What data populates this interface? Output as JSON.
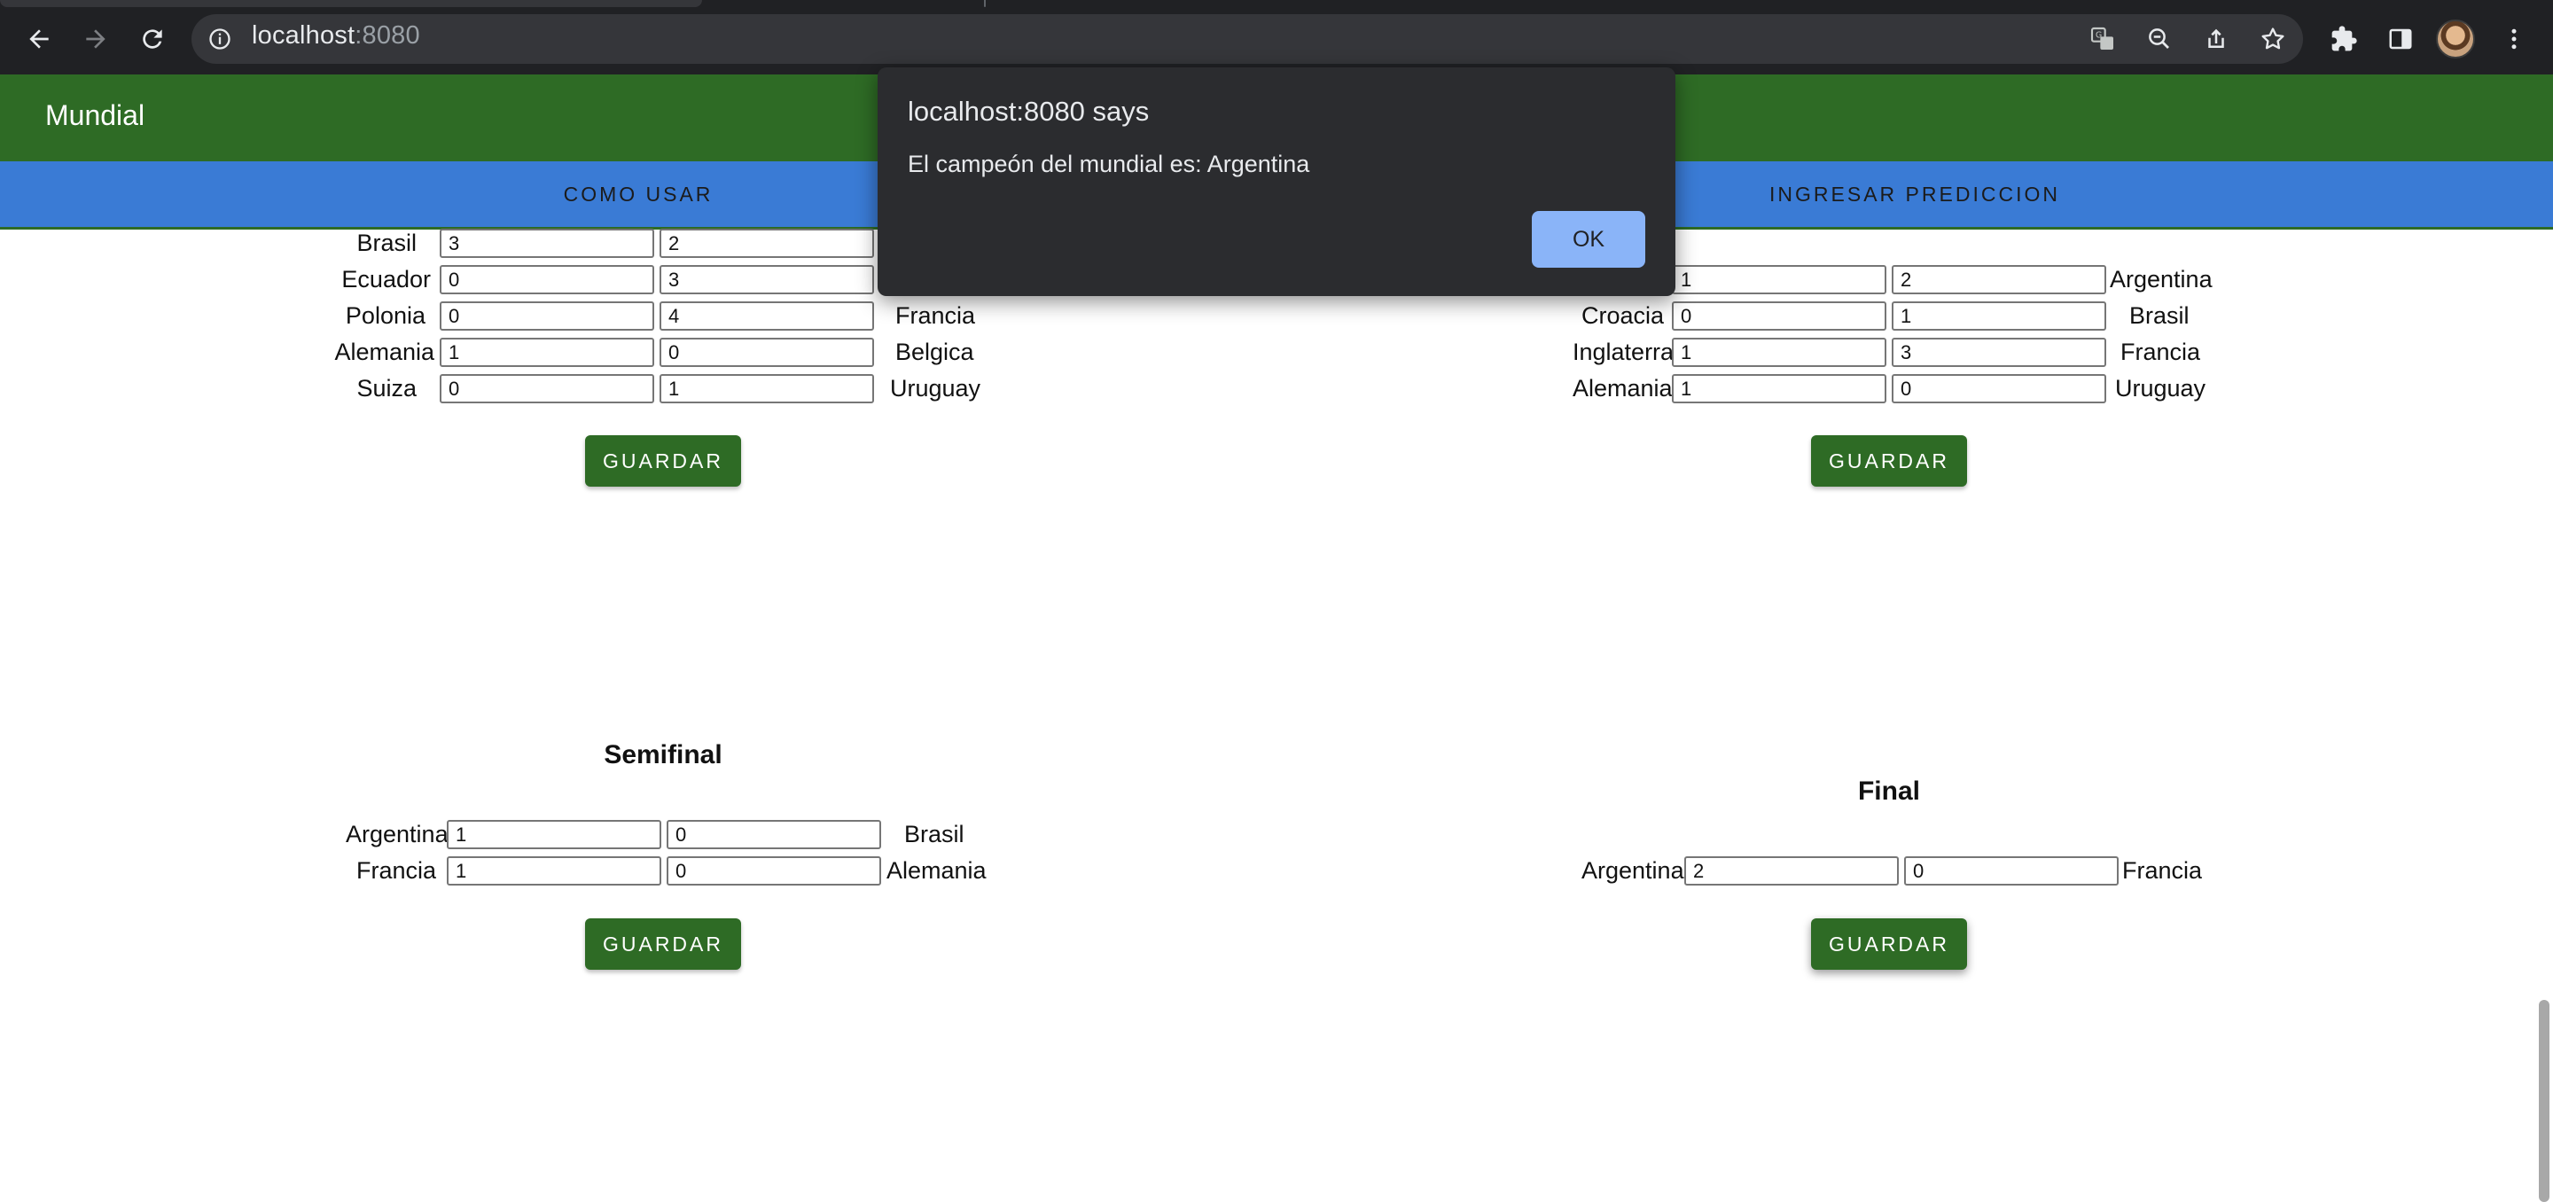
{
  "browser": {
    "url_host": "localhost",
    "url_port": ":8080"
  },
  "app": {
    "title": "Mundial",
    "tabs": [
      "COMO USAR",
      "INGRESAR PREDICCION"
    ]
  },
  "cuartos_left": {
    "rows": [
      {
        "home": "Brasil",
        "home_score": "3",
        "away_score": "2",
        "away": ""
      },
      {
        "home": "Ecuador",
        "home_score": "0",
        "away_score": "3",
        "away": ""
      },
      {
        "home": "Polonia",
        "home_score": "0",
        "away_score": "4",
        "away": "Francia"
      },
      {
        "home": "Alemania",
        "home_score": "1",
        "away_score": "0",
        "away": "Belgica"
      },
      {
        "home": "Suiza",
        "home_score": "0",
        "away_score": "1",
        "away": "Uruguay"
      }
    ],
    "save_label": "GUARDAR"
  },
  "cuartos_right": {
    "rows": [
      {
        "home": "",
        "home_score": "1",
        "away_score": "2",
        "away": "Argentina"
      },
      {
        "home": "Croacia",
        "home_score": "0",
        "away_score": "1",
        "away": "Brasil"
      },
      {
        "home": "Inglaterra",
        "home_score": "1",
        "away_score": "3",
        "away": "Francia"
      },
      {
        "home": "Alemania",
        "home_score": "1",
        "away_score": "0",
        "away": "Uruguay"
      }
    ],
    "save_label": "GUARDAR"
  },
  "semifinal": {
    "title": "Semifinal",
    "rows": [
      {
        "home": "Argentina",
        "home_score": "1",
        "away_score": "0",
        "away": "Brasil"
      },
      {
        "home": "Francia",
        "home_score": "1",
        "away_score": "0",
        "away": "Alemania"
      }
    ],
    "save_label": "GUARDAR"
  },
  "final": {
    "title": "Final",
    "rows": [
      {
        "home": "Argentina",
        "home_score": "2",
        "away_score": "0",
        "away": "Francia"
      }
    ],
    "save_label": "GUARDAR"
  },
  "dialog": {
    "title": "localhost:8080 says",
    "message": "El campeón del mundial es: Argentina",
    "ok_label": "OK"
  },
  "colors": {
    "appbar_green": "#2e6b25",
    "tabs_blue": "#3a7bd5",
    "dialog_bg": "#2b2c2f",
    "dialog_button": "#8ab4f8"
  },
  "icons": [
    "back-arrow-icon",
    "forward-arrow-icon",
    "reload-icon",
    "info-icon",
    "translate-icon",
    "zoom-out-icon",
    "share-icon",
    "bookmark-star-icon",
    "extensions-icon",
    "side-panel-icon",
    "menu-dots-icon"
  ]
}
